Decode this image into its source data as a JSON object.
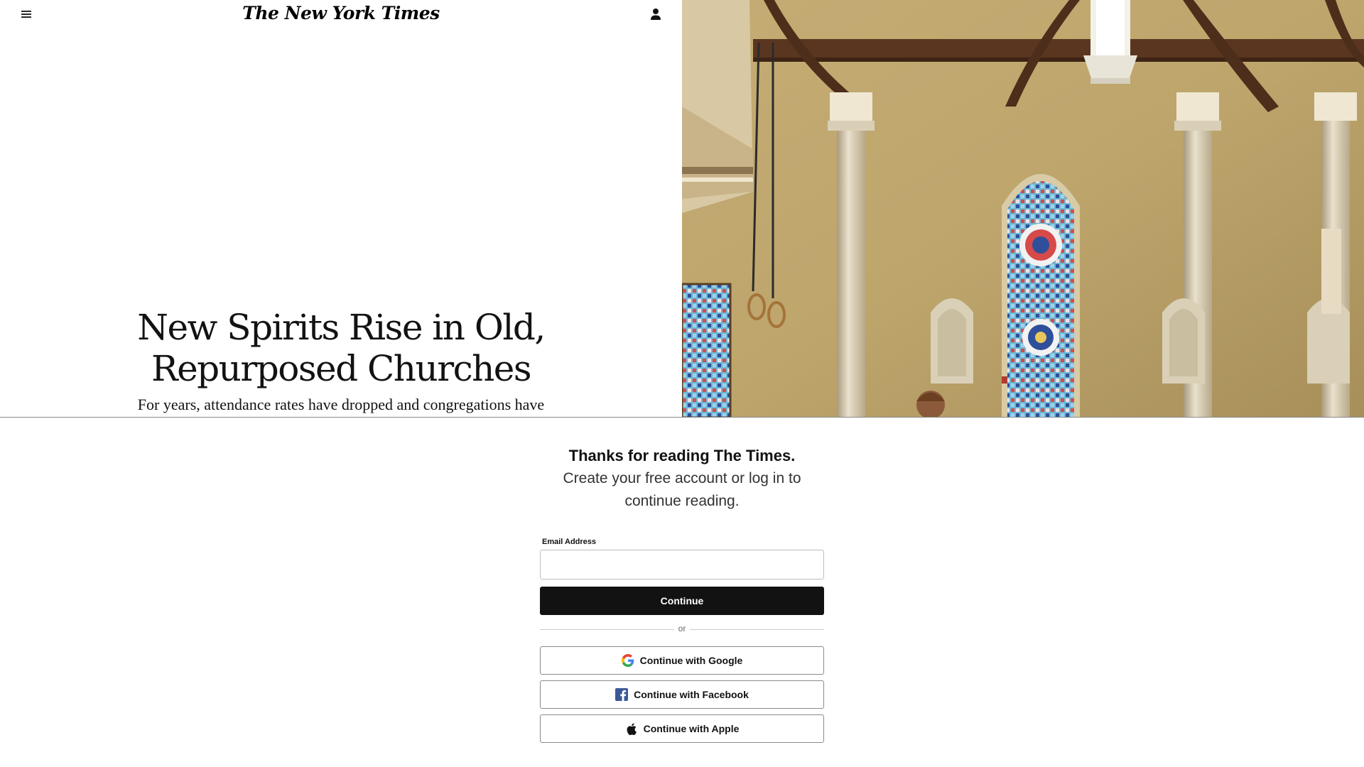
{
  "header": {
    "logo": "The New York Times",
    "menu_icon": "hamburger-menu-icon",
    "account_icon": "user-account-icon"
  },
  "article": {
    "headline": "New Spirits Rise in Old, Repurposed Churches",
    "summary": "For years, attendance rates have dropped and congregations have",
    "photo_alt": "Church interior with stained glass windows and gymnastic rings"
  },
  "regwall": {
    "title": "Thanks for reading The Times.",
    "subtitle": "Create your free account or log in to continue reading.",
    "email_label": "Email Address",
    "email_value": "",
    "continue_label": "Continue",
    "divider_text": "or",
    "google_label": "Continue with Google",
    "facebook_label": "Continue with Facebook",
    "apple_label": "Continue with Apple"
  },
  "colors": {
    "text": "#121212",
    "button_bg": "#121212",
    "button_text": "#ffffff",
    "divider": "#cccccc",
    "facebook_blue": "#3b5998",
    "google_blue": "#4285F4",
    "google_red": "#EA4335",
    "google_yellow": "#FBBC05",
    "google_green": "#34A853"
  }
}
